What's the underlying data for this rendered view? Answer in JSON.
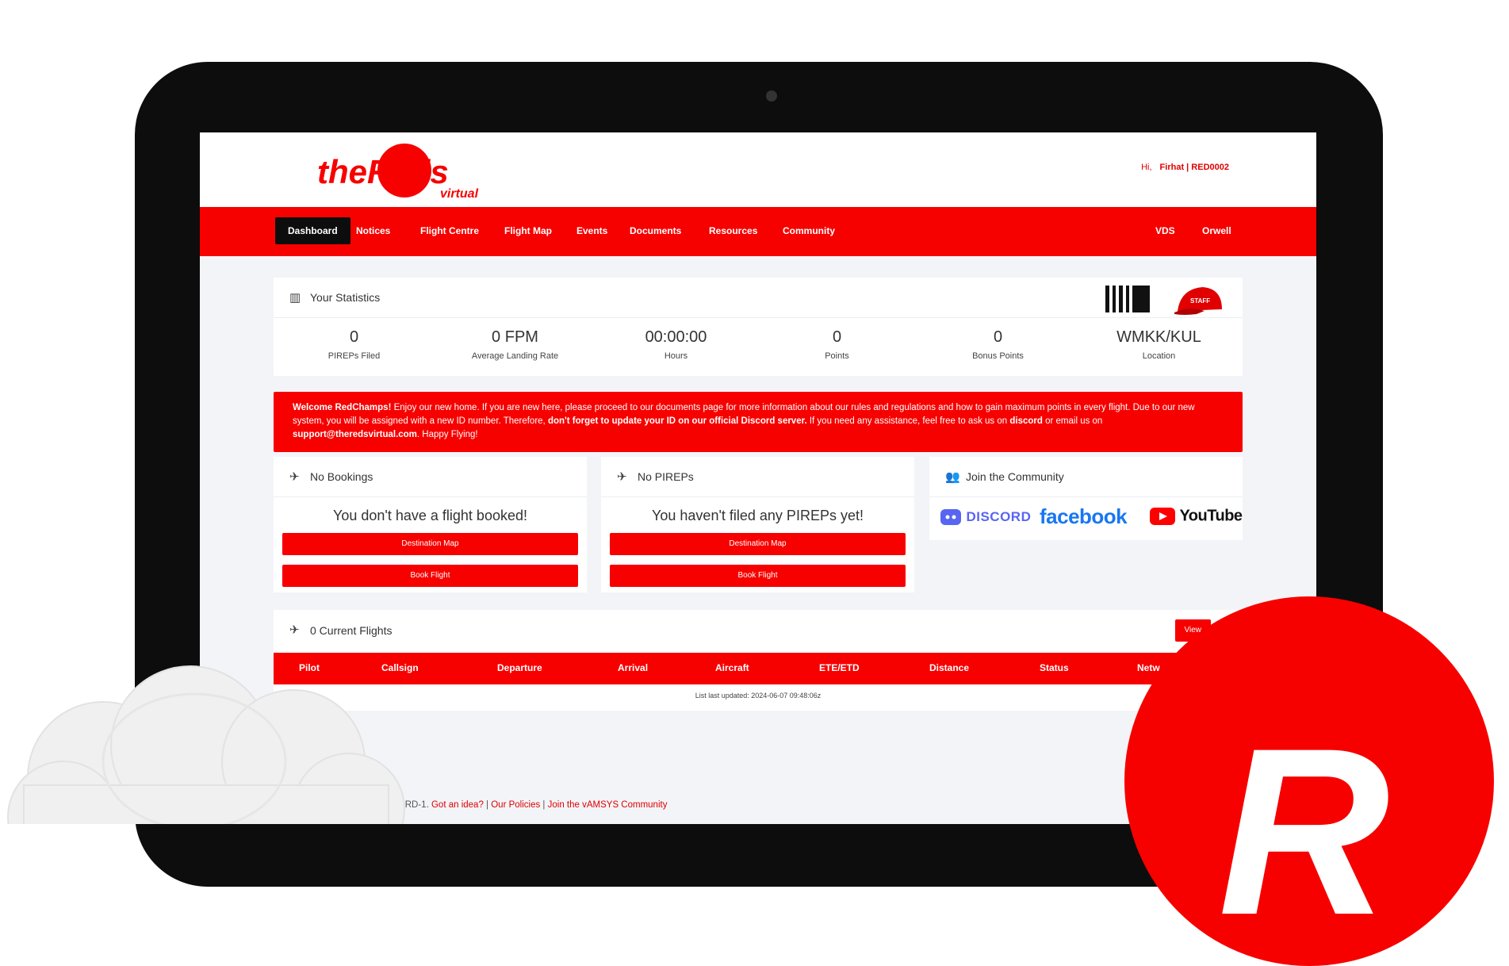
{
  "header": {
    "brand_main": "theReds",
    "brand_sub": "virtual",
    "greeting": "Hi,",
    "user": "Firhat | RED0002"
  },
  "nav": {
    "items": [
      "Dashboard",
      "Notices",
      "Flight Centre",
      "Flight Map",
      "Events",
      "Documents",
      "Resources",
      "Community"
    ],
    "right_items": [
      "VDS",
      "Orwell"
    ],
    "active": "Dashboard"
  },
  "stats": {
    "title": "Your Statistics",
    "badge_text": "STAFF",
    "items": [
      {
        "value": "0",
        "label": "PIREPs Filed"
      },
      {
        "value": "0 FPM",
        "label": "Average Landing Rate"
      },
      {
        "value": "00:00:00",
        "label": "Hours"
      },
      {
        "value": "0",
        "label": "Points"
      },
      {
        "value": "0",
        "label": "Bonus Points"
      },
      {
        "value": "WMKK/KUL",
        "label": "Location"
      }
    ]
  },
  "alert": {
    "p1_bold": "Welcome RedChamps!",
    "p1": " Enjoy our new home. If you are new here, please proceed to our documents page for more information about our rules and regulations and how to gain maximum points in every flight. Due to our new system, you will be assigned with a new ID number. Therefore, ",
    "p2_bold": "don't forget to update your ID on our official Discord server.",
    "p2": " If you need any assistance, feel free to ask us on ",
    "p3_bold": "discord",
    "p3": " or email us on ",
    "p4_bold": "support@theredsvirtual.com",
    "p4": ". Happy Flying!"
  },
  "bookings": {
    "title": "No Bookings",
    "message": "You don't have a flight booked!",
    "btn1": "Destination Map",
    "btn2": "Book Flight"
  },
  "pireps": {
    "title": "No PIREPs",
    "message": "You haven't filed any PIREPs yet!",
    "btn1": "Destination Map",
    "btn2": "Book Flight"
  },
  "community": {
    "title": "Join the Community",
    "discord": "DISCORD",
    "facebook": "facebook",
    "youtube": "YouTube"
  },
  "flights": {
    "title": "0 Current Flights",
    "view_btn": "View",
    "columns": [
      "Pilot",
      "Callsign",
      "Departure",
      "Arrival",
      "Aircraft",
      "ETE/ETD",
      "Distance",
      "Status",
      "Netw"
    ],
    "updated": "List last updated: 2024-06-07 09:48:06z"
  },
  "footer": {
    "text": "ved by PRD-1.",
    "links": [
      "Got an idea?",
      "Our Policies",
      "Join the vAMSYS Community"
    ]
  },
  "badge_letter": "R",
  "colors": {
    "brand_red": "#f70000",
    "dark": "#0d0d0d",
    "bg": "#f3f4f8"
  }
}
